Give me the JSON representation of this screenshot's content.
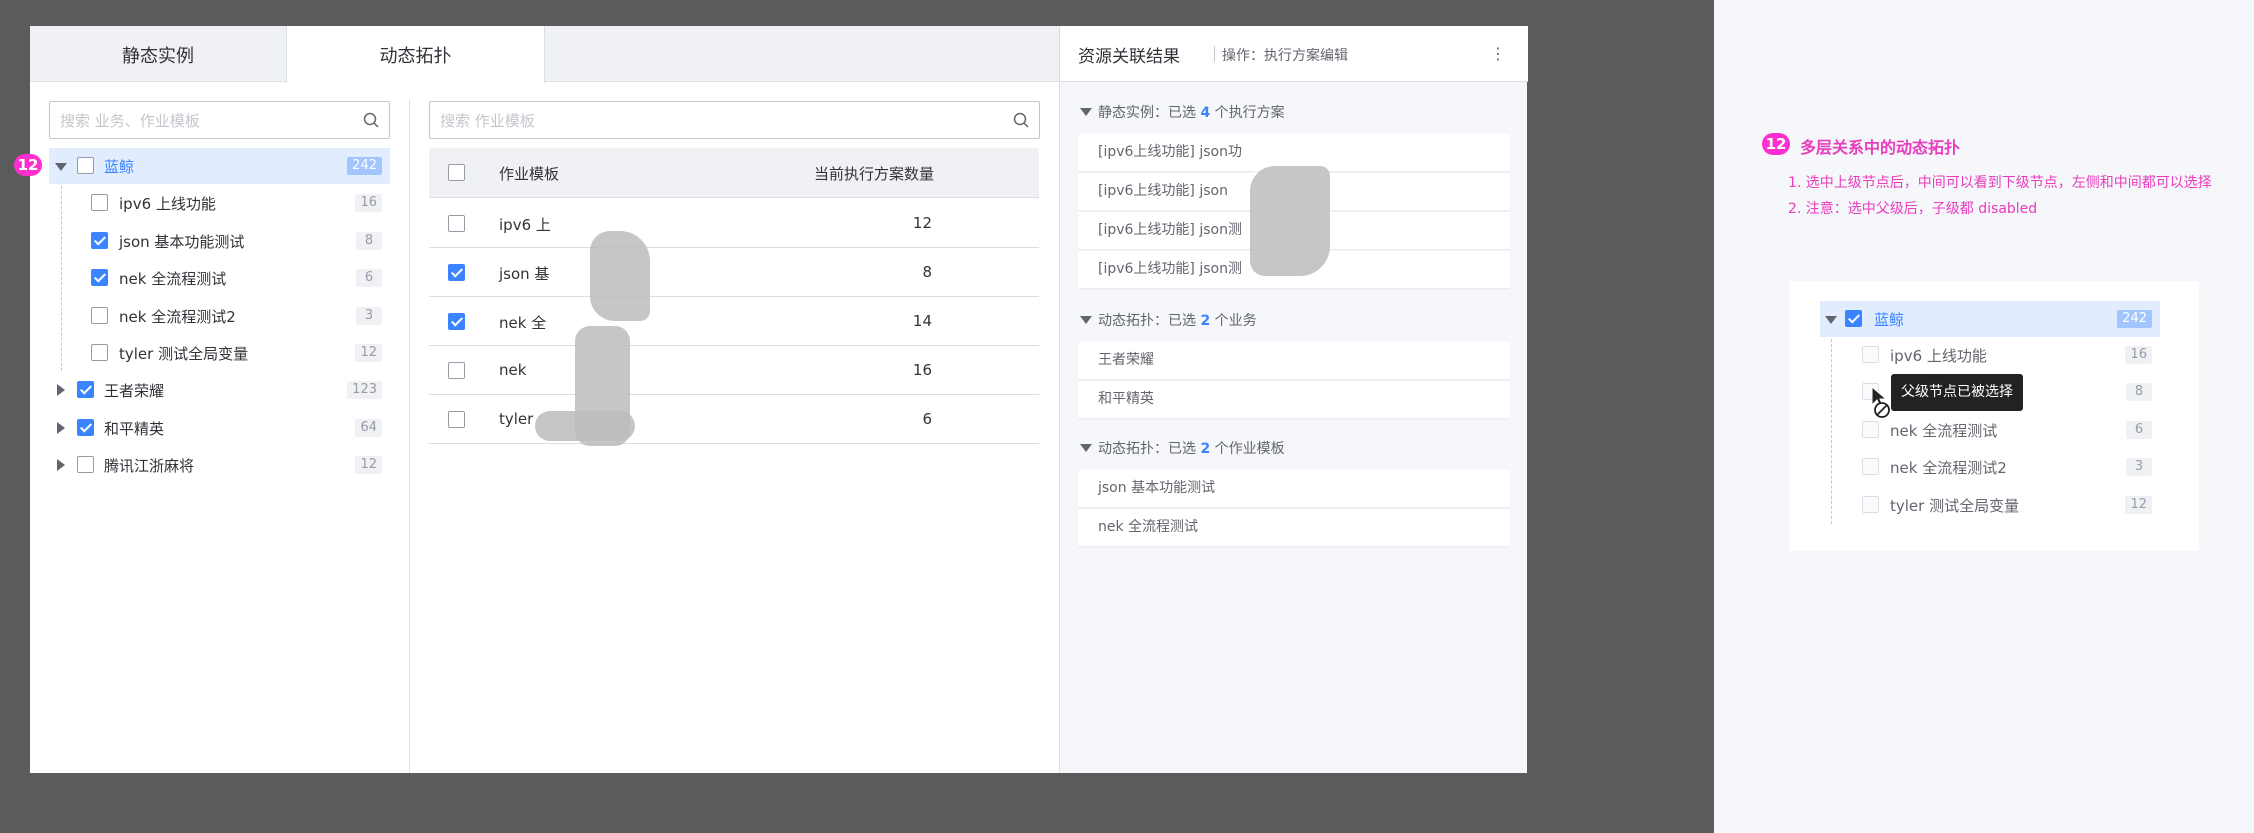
{
  "tabs": [
    "静态实例",
    "动态拓扑"
  ],
  "left_search_placeholder": "搜索 业务、作业模板",
  "mid_search_placeholder": "搜索 作业模板",
  "tree": {
    "root": {
      "label": "蓝鲸",
      "count": "242"
    },
    "children": [
      {
        "label": "ipv6 上线功能",
        "count": "16",
        "checked": false
      },
      {
        "label": "json 基本功能测试",
        "count": "8",
        "checked": true
      },
      {
        "label": "nek 全流程测试",
        "count": "6",
        "checked": true
      },
      {
        "label": "nek 全流程测试2",
        "count": "3",
        "checked": false
      },
      {
        "label": "tyler 测试全局变量",
        "count": "12",
        "checked": false
      }
    ],
    "others": [
      {
        "label": "王者荣耀",
        "count": "123",
        "checked": true
      },
      {
        "label": "和平精英",
        "count": "64",
        "checked": true
      },
      {
        "label": "腾讯江浙麻将",
        "count": "12",
        "checked": false
      }
    ]
  },
  "table": {
    "col_name": "作业模板",
    "col_count": "当前执行方案数量",
    "rows": [
      {
        "name": "ipv6 上",
        "count": "12",
        "checked": false
      },
      {
        "name": "json 基",
        "count": "8",
        "checked": true
      },
      {
        "name": "nek 全",
        "count": "14",
        "checked": true
      },
      {
        "name": "nek",
        "count": "16",
        "checked": false
      },
      {
        "name": "tyler",
        "count": "6",
        "checked": false
      }
    ]
  },
  "result": {
    "title": "资源关联结果",
    "subtitle": "操作：执行方案编辑",
    "more": "⋮",
    "group1": {
      "prefix": "静态实例：已选 ",
      "count": "4",
      "suffix": " 个执行方案"
    },
    "group1_items": [
      "[ipv6上线功能] json功",
      "[ipv6上线功能] json",
      "[ipv6上线功能] json测",
      "[ipv6上线功能] json测"
    ],
    "group2": {
      "prefix": "动态拓扑：已选 ",
      "count": "2",
      "suffix": " 个业务"
    },
    "group2_items": [
      "王者荣耀",
      "和平精英"
    ],
    "group3": {
      "prefix": "动态拓扑：已选 ",
      "count": "2",
      "suffix": " 个作业模板"
    },
    "group3_items": [
      "json 基本功能测试",
      "nek 全流程测试"
    ]
  },
  "annotation": {
    "badge": "12",
    "title": "多层关系中的动态拓扑",
    "line1": "1. 选中上级节点后，中间可以看到下级节点，左侧和中间都可以选择",
    "line2": "2. 注意：选中父级后，子级都 disabled"
  },
  "card": {
    "root": {
      "label": "蓝鲸",
      "count": "242"
    },
    "children": [
      {
        "label": "ipv6 上线功能",
        "count": "16"
      },
      {
        "label": "",
        "count": "8"
      },
      {
        "label": "nek 全流程测试",
        "count": "6"
      },
      {
        "label": "nek 全流程测试2",
        "count": "3"
      },
      {
        "label": "tyler 测试全局变量",
        "count": "12"
      }
    ],
    "tooltip": "父级节点已被选择"
  },
  "colors": {
    "accent": "#3a84ff",
    "annotation": "#ff2fcf"
  }
}
